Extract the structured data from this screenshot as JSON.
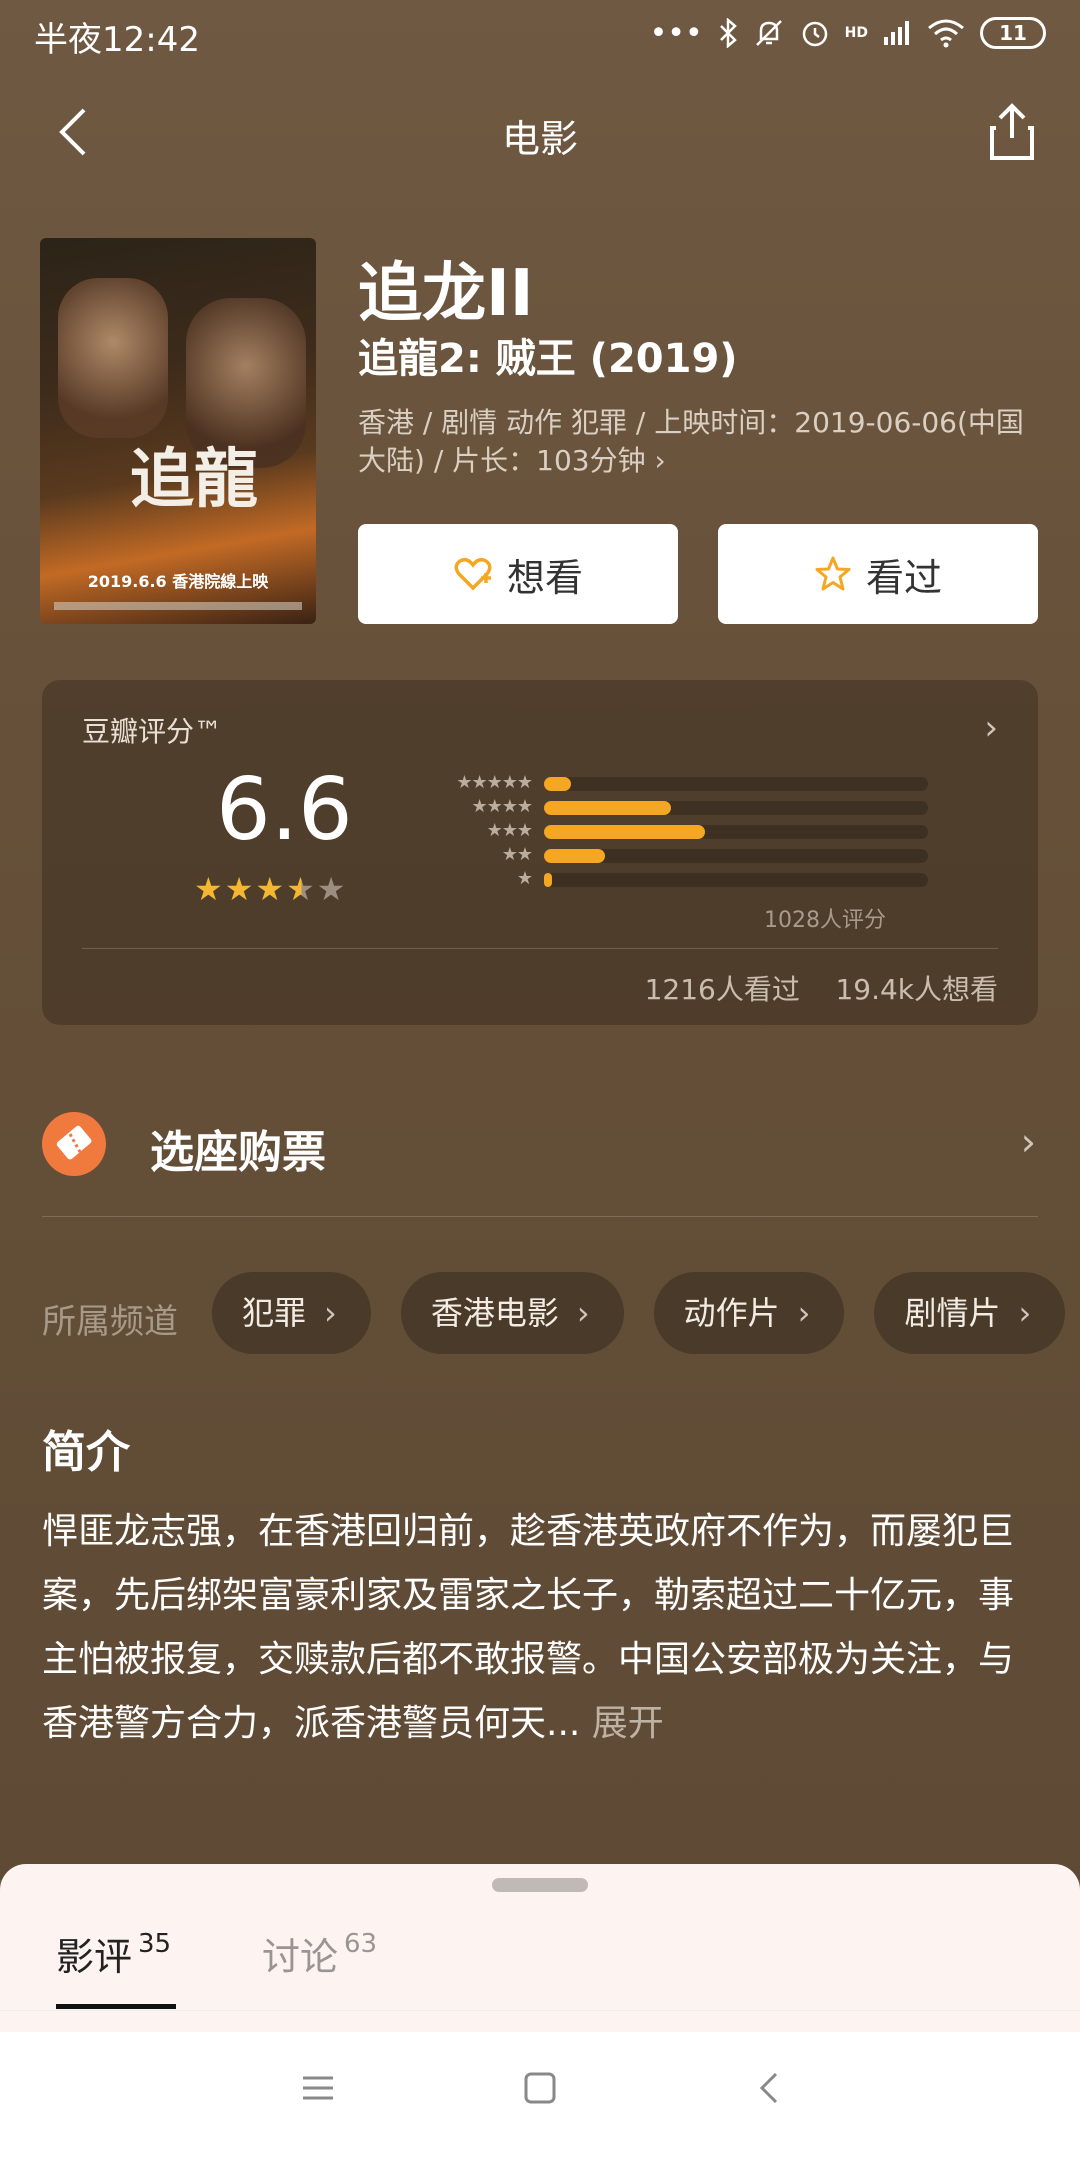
{
  "status_bar": {
    "time": "半夜12:42",
    "signal": "HD",
    "battery": "11"
  },
  "nav": {
    "title": "电影"
  },
  "movie": {
    "poster_title": "追龍",
    "poster_date": "2019.6.6 香港院線上映",
    "title": "追龙II",
    "original_title": "追龍2: 贼王 (2019)",
    "meta": "香港 / 剧情 动作 犯罪 / 上映时间：2019-06-06(中国大陆) / 片长：103分钟 ›"
  },
  "actions": {
    "want": "想看",
    "seen": "看过"
  },
  "rating": {
    "label": "豆瓣评分™",
    "score": "6.6",
    "stars": 3.5,
    "distribution": [
      {
        "stars": "★★★★★",
        "percent": 7
      },
      {
        "stars": "★★★★",
        "percent": 33
      },
      {
        "stars": "★★★",
        "percent": 42
      },
      {
        "stars": "★★",
        "percent": 16
      },
      {
        "stars": "★",
        "percent": 2
      }
    ],
    "count": "1028人评分",
    "viewers": "1216人看过    19.4k人想看"
  },
  "ticket": {
    "label": "选座购票"
  },
  "channels": {
    "label": "所属频道",
    "items": [
      "犯罪",
      "香港电影",
      "动作片",
      "剧情片"
    ]
  },
  "intro": {
    "heading": "简介",
    "text": "悍匪龙志强，在香港回归前，趁香港英政府不作为，而屡犯巨案，先后绑架富豪利家及雷家之长子，勒索超过二十亿元，事主怕被报复，交赎款后都不敢报警。中国公安部极为关注，与香港警方合力，派香港警员何天...",
    "expand": "展开"
  },
  "sheet": {
    "tabs": [
      {
        "label": "影评",
        "count": "35"
      },
      {
        "label": "讨论",
        "count": "63"
      }
    ]
  },
  "colors": {
    "accent": "#f5a623",
    "ticket": "#f07a3e",
    "background": "#6b5540"
  }
}
